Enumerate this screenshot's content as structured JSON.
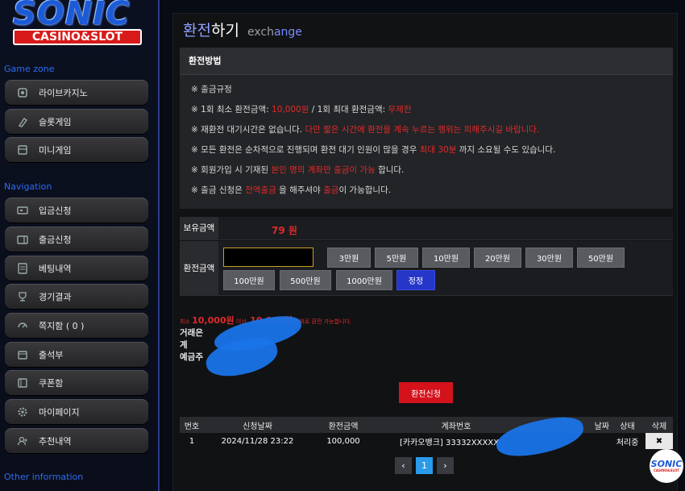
{
  "brand": {
    "name": "SONIC",
    "sub": "CASINO&SLOT"
  },
  "sidebar": {
    "game_zone_title": "Game zone",
    "game_items": [
      {
        "label": "라이브카지노",
        "icon": "casino-chip-icon"
      },
      {
        "label": "슬롯게임",
        "icon": "slot-icon"
      },
      {
        "label": "미니게임",
        "icon": "mini-game-icon"
      }
    ],
    "navigation_title": "Navigation",
    "nav_items": [
      {
        "label": "입금신청",
        "icon": "deposit-icon"
      },
      {
        "label": "출금신청",
        "icon": "withdraw-icon"
      },
      {
        "label": "베팅내역",
        "icon": "betting-history-icon"
      },
      {
        "label": "경기결과",
        "icon": "result-icon"
      },
      {
        "label": "쪽지함 ( 0 )",
        "icon": "message-icon"
      },
      {
        "label": "출석부",
        "icon": "attendance-icon"
      },
      {
        "label": "쿠폰함",
        "icon": "coupon-icon"
      },
      {
        "label": "마이페이지",
        "icon": "settings-icon"
      },
      {
        "label": "추천내역",
        "icon": "referral-icon"
      }
    ],
    "other_title": "Other information"
  },
  "page": {
    "title_accent": "환전",
    "title_rest": "하기",
    "title_en_a": "exch",
    "title_en_b": "ange"
  },
  "info": {
    "header": "환전방법",
    "mark": "※",
    "line1": "출금규정",
    "line2_a": "1회 최소 환전금액: ",
    "line2_b": "10,000원",
    "line2_c": " / 1회 최대 환전금액: ",
    "line2_d": "무제한",
    "line3_a": "재환전 대기시간은 없습니다. ",
    "line3_b": "다만 짧은 시간에 환전을 계속 누르는 행위는 피해주시길 바랍니다.",
    "line4_a": "모든 환전은 순차적으로 진행되며 환전 대기 인원이 많을 경우 ",
    "line4_b": "최대 30분",
    "line4_c": " 까지 소요될 수도 있습니다.",
    "line5_a": "회원가입 시 기재된 ",
    "line5_b": "본인 명의 계좌만 출금이 가능",
    "line5_c": " 합니다.",
    "line6_a": "출금 신청은 ",
    "line6_b": "전액출금",
    "line6_c": " 을 해주셔야 ",
    "line6_d": "출금",
    "line6_e": "이 가능합니다."
  },
  "form": {
    "balance_label": "보유금액",
    "balance_value": "79 원",
    "amount_label": "환전금액",
    "amount_value": "",
    "buttons": [
      "3만원",
      "5만원",
      "10만원",
      "20만원",
      "30만원",
      "50만원",
      "100만원",
      "500만원",
      "1000만원",
      "정정"
    ],
    "notice_a": "최소 ",
    "notice_b": "10,000원",
    "notice_c": " 이상, ",
    "notice_d": "10,000원",
    "notice_e": " 단위로 환전 가능합니다.",
    "account_labels": [
      "거래은",
      "계",
      "예금주"
    ],
    "submit_label": "환전신청"
  },
  "table": {
    "headers": [
      "번호",
      "신청날짜",
      "환전금액",
      "계좌번호",
      "날짜",
      "상태",
      "삭제"
    ],
    "row": {
      "no": "1",
      "date": "2024/11/28 23:22",
      "amount": "100,000",
      "account": "[카카오뱅크] 33332XXXXX",
      "status": "처리중",
      "delete": "✖"
    }
  },
  "pager": {
    "prev": "‹",
    "current": "1",
    "next": "›"
  },
  "mini_logo": {
    "word": "SONIC",
    "sub": "CASINO&SLOT"
  },
  "colors": {
    "accent_red": "#e02a2a",
    "accent_blue": "#2d6cf0",
    "button_blue": "#2536c8",
    "submit_red": "#d4121c"
  }
}
